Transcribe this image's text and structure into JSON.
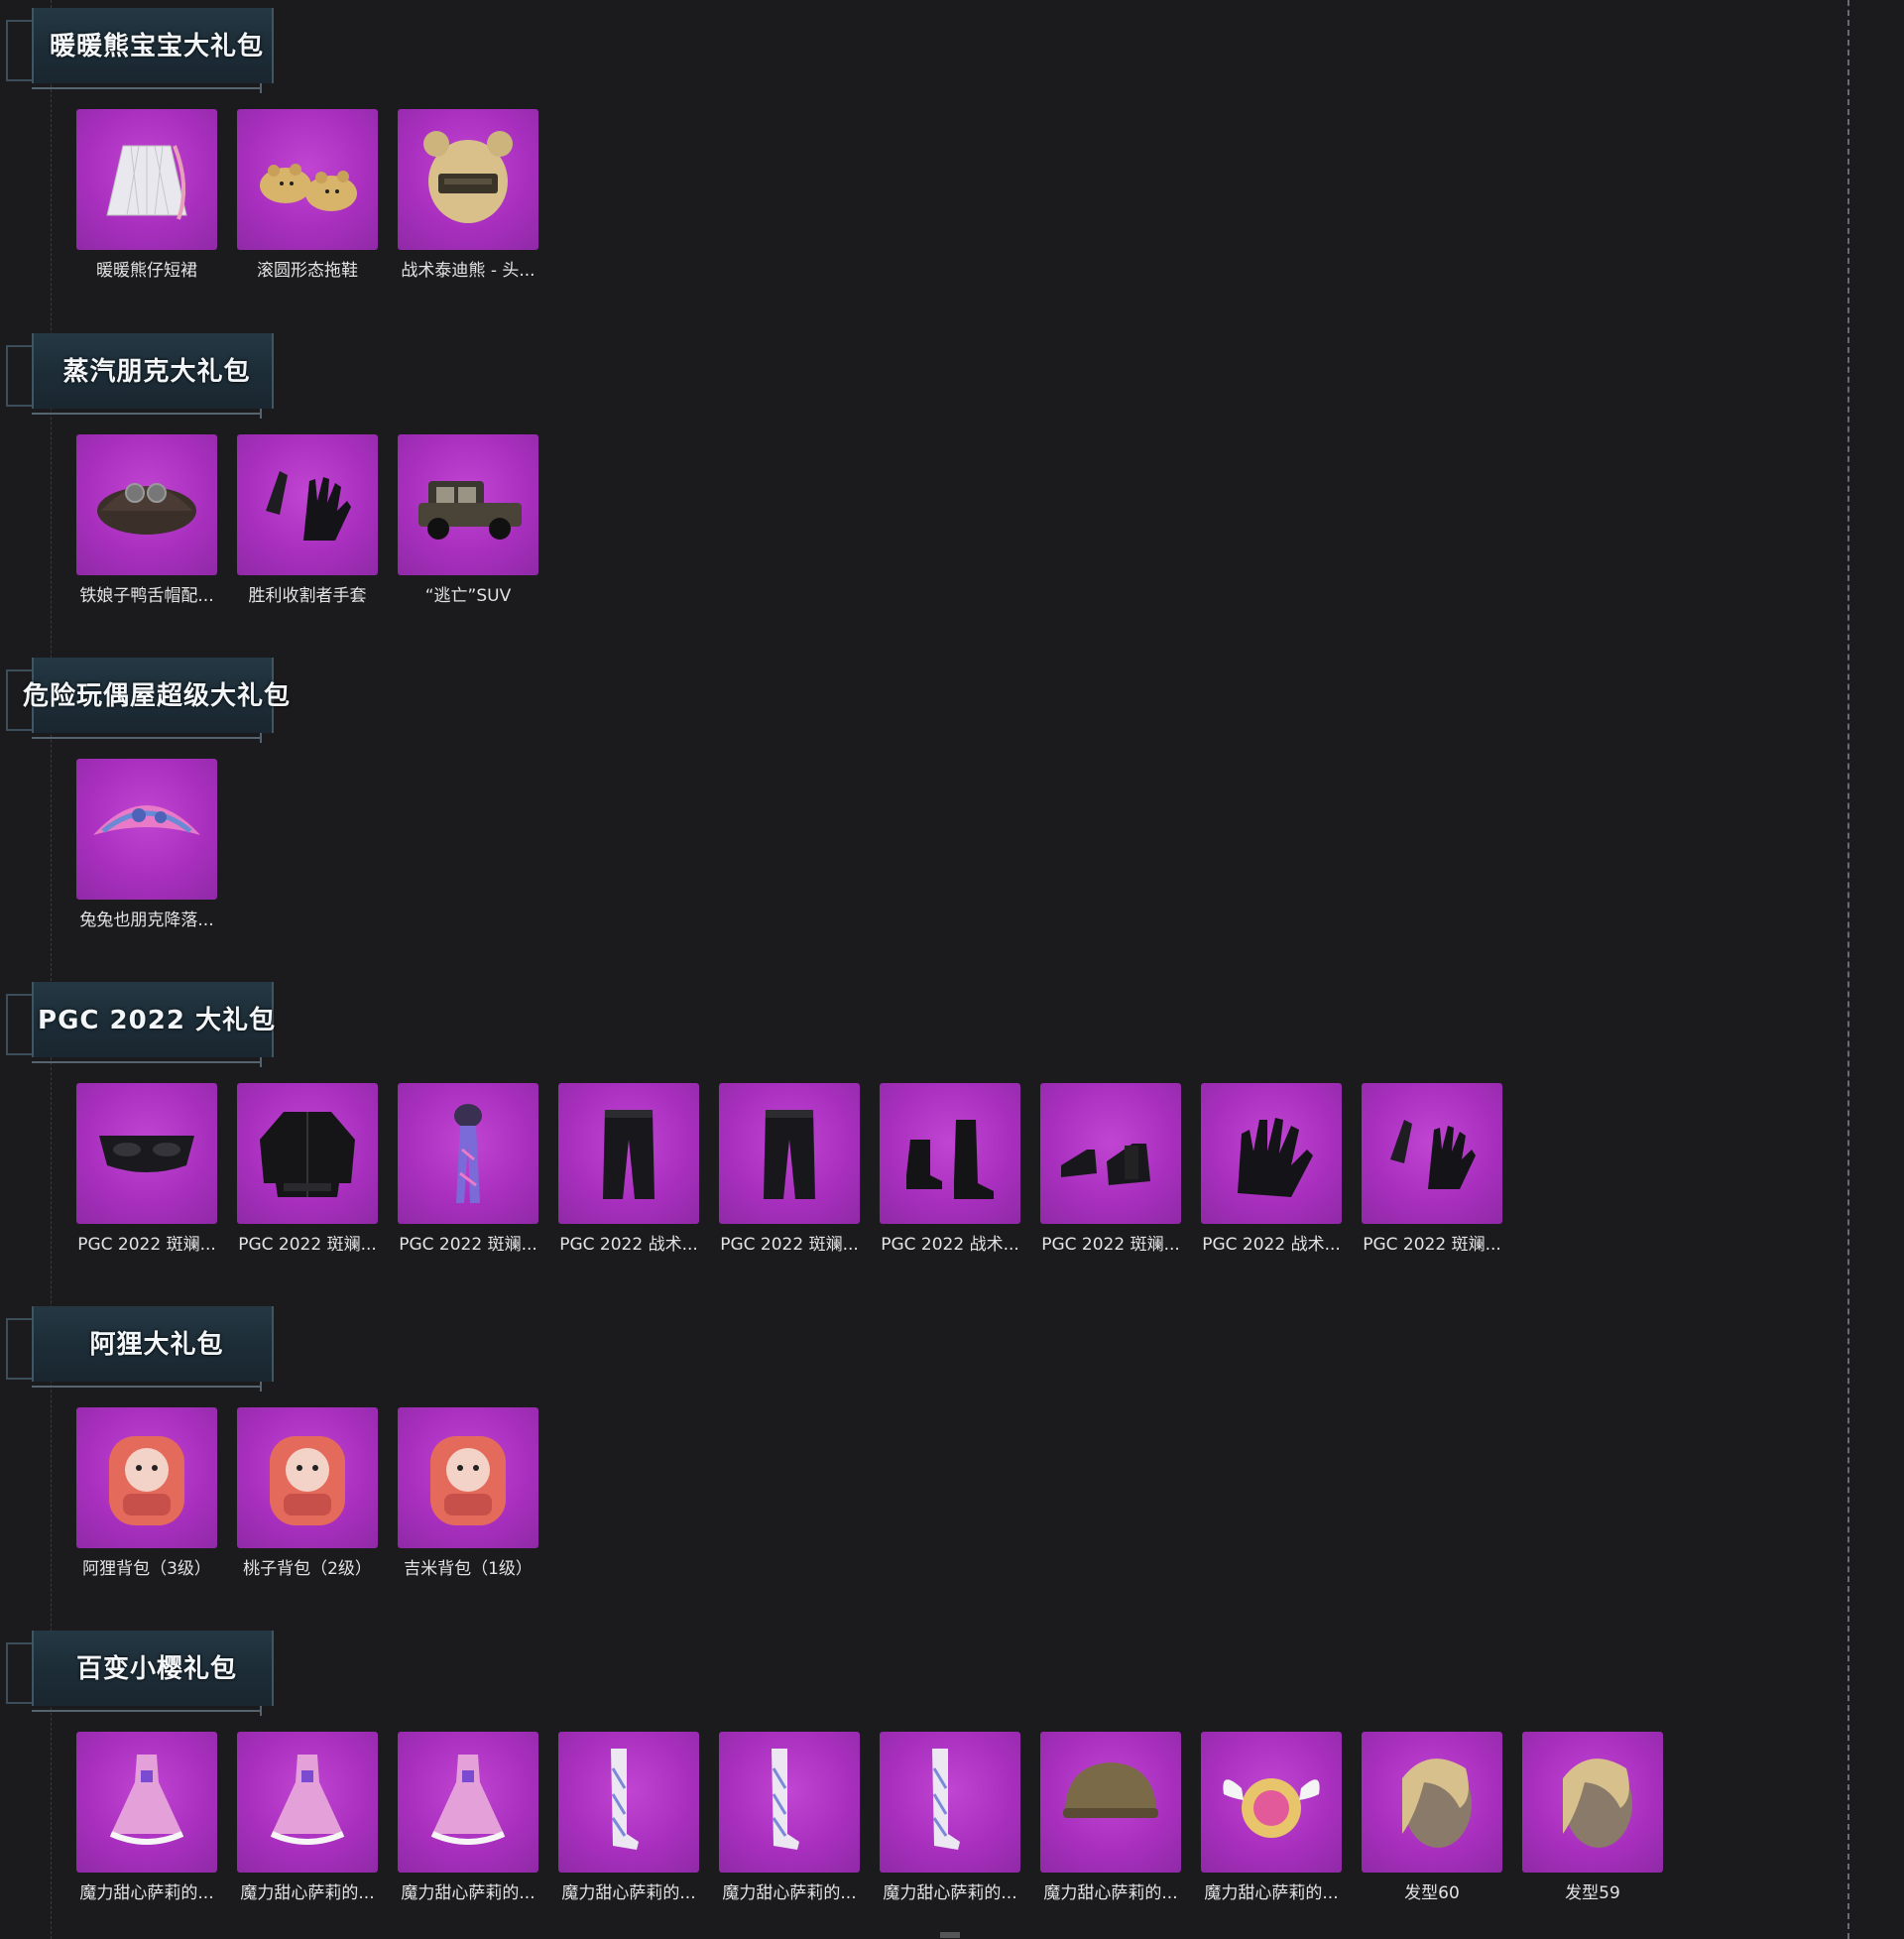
{
  "sections": [
    {
      "title": "暖暖熊宝宝大礼包",
      "items": [
        {
          "name": "暖暖熊仔短裙",
          "icon": "skirt-icon"
        },
        {
          "name": "滚圆形态拖鞋",
          "icon": "bear-slippers-icon"
        },
        {
          "name": "战术泰迪熊 - 头...",
          "icon": "bear-helmet-icon"
        }
      ]
    },
    {
      "title": "蒸汽朋克大礼包",
      "items": [
        {
          "name": "铁娘子鸭舌帽配...",
          "icon": "cap-icon"
        },
        {
          "name": "胜利收割者手套",
          "icon": "gloves-icon"
        },
        {
          "name": "“逃亡”SUV",
          "icon": "vintage-car-icon"
        }
      ]
    },
    {
      "title": "危险玩偶屋超级大礼包",
      "items": [
        {
          "name": "兔兔也朋克降落...",
          "icon": "parachute-icon"
        }
      ]
    },
    {
      "title": "PGC 2022 大礼包",
      "items": [
        {
          "name": "PGC 2022 斑斓...",
          "icon": "mask-icon"
        },
        {
          "name": "PGC 2022 斑斓...",
          "icon": "jacket-icon"
        },
        {
          "name": "PGC 2022 斑斓...",
          "icon": "scarf-icon"
        },
        {
          "name": "PGC 2022 战术...",
          "icon": "pants-icon"
        },
        {
          "name": "PGC 2022 斑斓...",
          "icon": "pants-icon"
        },
        {
          "name": "PGC 2022 战术...",
          "icon": "boots-icon"
        },
        {
          "name": "PGC 2022 斑斓...",
          "icon": "shoes-icon"
        },
        {
          "name": "PGC 2022 战术...",
          "icon": "glove-icon"
        },
        {
          "name": "PGC 2022 斑斓...",
          "icon": "gloves-icon"
        }
      ]
    },
    {
      "title": "阿狸大礼包",
      "items": [
        {
          "name": "阿狸背包（3级）",
          "icon": "backpack-icon"
        },
        {
          "name": "桃子背包（2级）",
          "icon": "backpack-icon"
        },
        {
          "name": "吉米背包（1级）",
          "icon": "backpack-icon"
        }
      ]
    },
    {
      "title": "百变小樱礼包",
      "items": [
        {
          "name": "魔力甜心萨莉的...",
          "icon": "dress-icon"
        },
        {
          "name": "魔力甜心萨莉的...",
          "icon": "dress-icon"
        },
        {
          "name": "魔力甜心萨莉的...",
          "icon": "dress-icon"
        },
        {
          "name": "魔力甜心萨莉的...",
          "icon": "stockings-icon"
        },
        {
          "name": "魔力甜心萨莉的...",
          "icon": "stockings-icon"
        },
        {
          "name": "魔力甜心萨莉的...",
          "icon": "stockings-icon"
        },
        {
          "name": "魔力甜心萨莉的...",
          "icon": "helmet-icon"
        },
        {
          "name": "魔力甜心萨莉的...",
          "icon": "winged-bag-icon"
        },
        {
          "name": "发型60",
          "icon": "hair-icon"
        },
        {
          "name": "发型59",
          "icon": "hair-icon"
        }
      ]
    }
  ],
  "colors": {
    "background": "#1b1b1d",
    "tile": "#a92fbf",
    "banner": "#243844"
  }
}
